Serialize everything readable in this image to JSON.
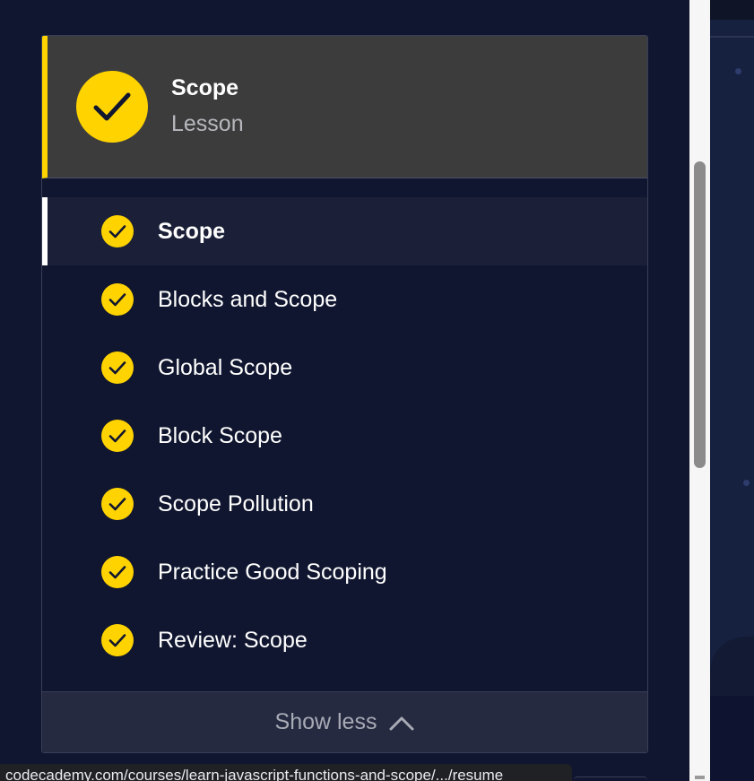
{
  "lesson": {
    "title": "Scope",
    "subtitle": "Lesson",
    "icon": "check-icon"
  },
  "items": [
    {
      "label": "Scope",
      "active": true,
      "status": "completed"
    },
    {
      "label": "Blocks and Scope",
      "status": "completed"
    },
    {
      "label": "Global Scope",
      "status": "completed"
    },
    {
      "label": "Block Scope",
      "status": "completed"
    },
    {
      "label": "Scope Pollution",
      "status": "completed"
    },
    {
      "label": "Practice Good Scoping",
      "status": "completed"
    },
    {
      "label": "Review: Scope",
      "status": "completed"
    }
  ],
  "show_less": {
    "label": "Show less",
    "icon": "chevron-up-icon"
  },
  "status_bar": {
    "url": "codecademy.com/courses/learn-javascript-functions-and-scope/.../resume"
  },
  "colors": {
    "accent": "#ffd300",
    "background": "#10162f",
    "header_bg": "#3c3c3d"
  }
}
